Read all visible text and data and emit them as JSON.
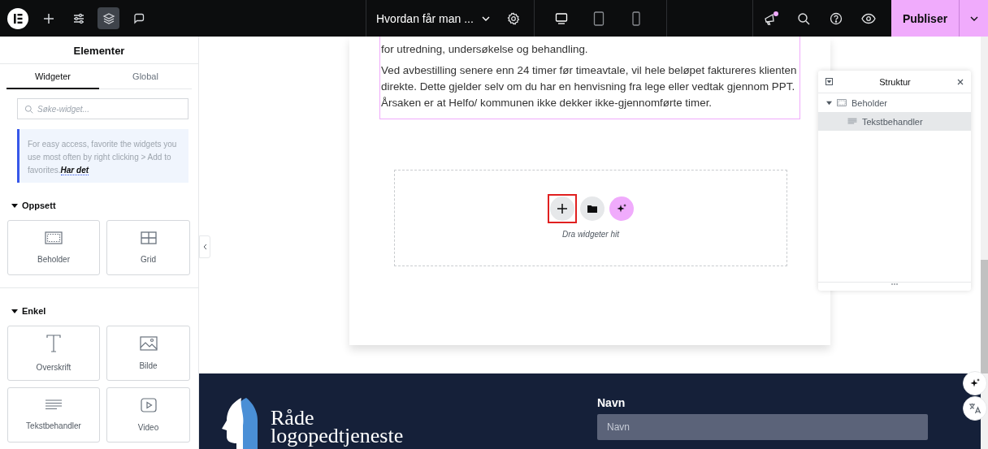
{
  "topbar": {
    "tools": [
      {
        "kind": "plus",
        "active": false
      },
      {
        "kind": "sliders",
        "active": false
      },
      {
        "kind": "layers",
        "active": true
      },
      {
        "kind": "comment",
        "active": false
      }
    ],
    "page_title": "Hvordan får man ...",
    "devices": [
      {
        "kind": "desktop",
        "selected": true
      },
      {
        "kind": "tablet",
        "selected": false
      },
      {
        "kind": "mobile",
        "selected": false
      }
    ],
    "whats_new_unread": true,
    "publish_button": "Publiser"
  },
  "panel": {
    "title": "Elementer",
    "tabs": [
      {
        "label": "Widgeter",
        "selected": true
      },
      {
        "label": "Global",
        "selected": false
      }
    ],
    "search": {
      "placeholder": "Søke-widget..."
    },
    "notice": {
      "text": "For easy access, favorite the widgets you use most often by right clicking > Add to favorites.",
      "link": "Har det"
    },
    "sections": [
      {
        "title": "Oppsett",
        "expanded": true,
        "widgets": [
          {
            "kind": "container",
            "label": "Beholder"
          },
          {
            "kind": "grid",
            "label": "Grid"
          }
        ]
      },
      {
        "title": "Enkel",
        "expanded": true,
        "widgets": [
          {
            "kind": "heading",
            "label": "Overskrift"
          },
          {
            "kind": "image",
            "label": "Bilde"
          },
          {
            "kind": "text",
            "label": "Tekstbehandler"
          },
          {
            "kind": "video",
            "label": "Video"
          }
        ]
      }
    ]
  },
  "canvas": {
    "paragraphs": [
      "for utredning, undersøkelse og behandling.",
      "Ved avbestilling senere enn 24 timer før timeavtale, vil hele beløpet faktureres klienten direkte. Dette gjelder selv om du har en henvisning fra lege eller vedtak gjennom PPT. Årsaken er at Helfo/ kommunen ikke dekker ikke-gjennomførte timer."
    ],
    "drop_zone": {
      "hint": "Dra widgeter hit"
    },
    "footer": {
      "brand_lines": [
        "Råde",
        "logopedtjeneste"
      ],
      "field_label": "Navn",
      "field_placeholder": "Navn"
    }
  },
  "structure": {
    "title": "Struktur",
    "tree": [
      {
        "label": "Beholder",
        "kind": "container",
        "expanded": true,
        "selected": false,
        "children": [
          {
            "label": "Tekstbehandler",
            "kind": "text",
            "selected": true
          }
        ]
      }
    ]
  }
}
